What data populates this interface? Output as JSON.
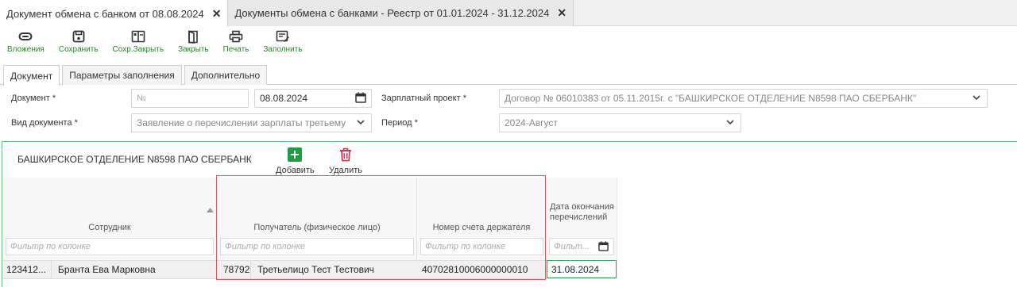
{
  "doc_tabs": [
    {
      "label": "Документ обмена с банком от 08.08.2024"
    },
    {
      "label": "Документы обмена с банками - Реестр от 01.01.2024 - 31.12.2024"
    }
  ],
  "toolbar": {
    "attachments": "Вложения",
    "save": "Сохранить",
    "save_close": "Сохр.Закрыть",
    "close": "Закрыть",
    "print": "Печать",
    "fill": "Заполнить"
  },
  "inner_tabs": [
    "Документ",
    "Параметры заполнения",
    "Дополнительно"
  ],
  "form": {
    "doc_label": "Документ *",
    "doc_number_placeholder": "№",
    "doc_date": "08.08.2024",
    "salary_project_label": "Зарплатный проект *",
    "salary_project_value": "Договор № 06010383 от 05.11.2015г. с \"БАШКИРСКОЕ ОТДЕЛЕНИЕ N8598 ПАО СБЕРБАНК\"",
    "doc_type_label": "Вид документа *",
    "doc_type_value": "Заявление о перечислении зарплаты третьему",
    "period_label": "Период *",
    "period_value": "2024-Август"
  },
  "panel": {
    "title": "БАШКИРСКОЕ ОТДЕЛЕНИЕ N8598 ПАО СБЕРБАНК",
    "add": "Добавить",
    "delete": "Удалить"
  },
  "grid": {
    "columns": [
      {
        "header": "Сотрудник"
      },
      {
        "header": "Получатель (физическое лицо)"
      },
      {
        "header": "Номер счета держателя"
      },
      {
        "header": "Дата окончания перечислений"
      }
    ],
    "filter_placeholder": "Фильтр по колонке",
    "filter_short": "Фильт...",
    "rows": [
      {
        "employee_code": "123412...",
        "employee_name": "Бранта Ева Марковна",
        "recipient_code": "78792",
        "recipient_name": "Третьелицо Тест Тестович",
        "account": "40702810006000000010",
        "end_date": "31.08.2024"
      }
    ]
  },
  "colors": {
    "accent_green": "#2e7d32",
    "add_green": "#1e9b45",
    "delete_red": "#d6334a",
    "highlight": "#e0585e"
  }
}
